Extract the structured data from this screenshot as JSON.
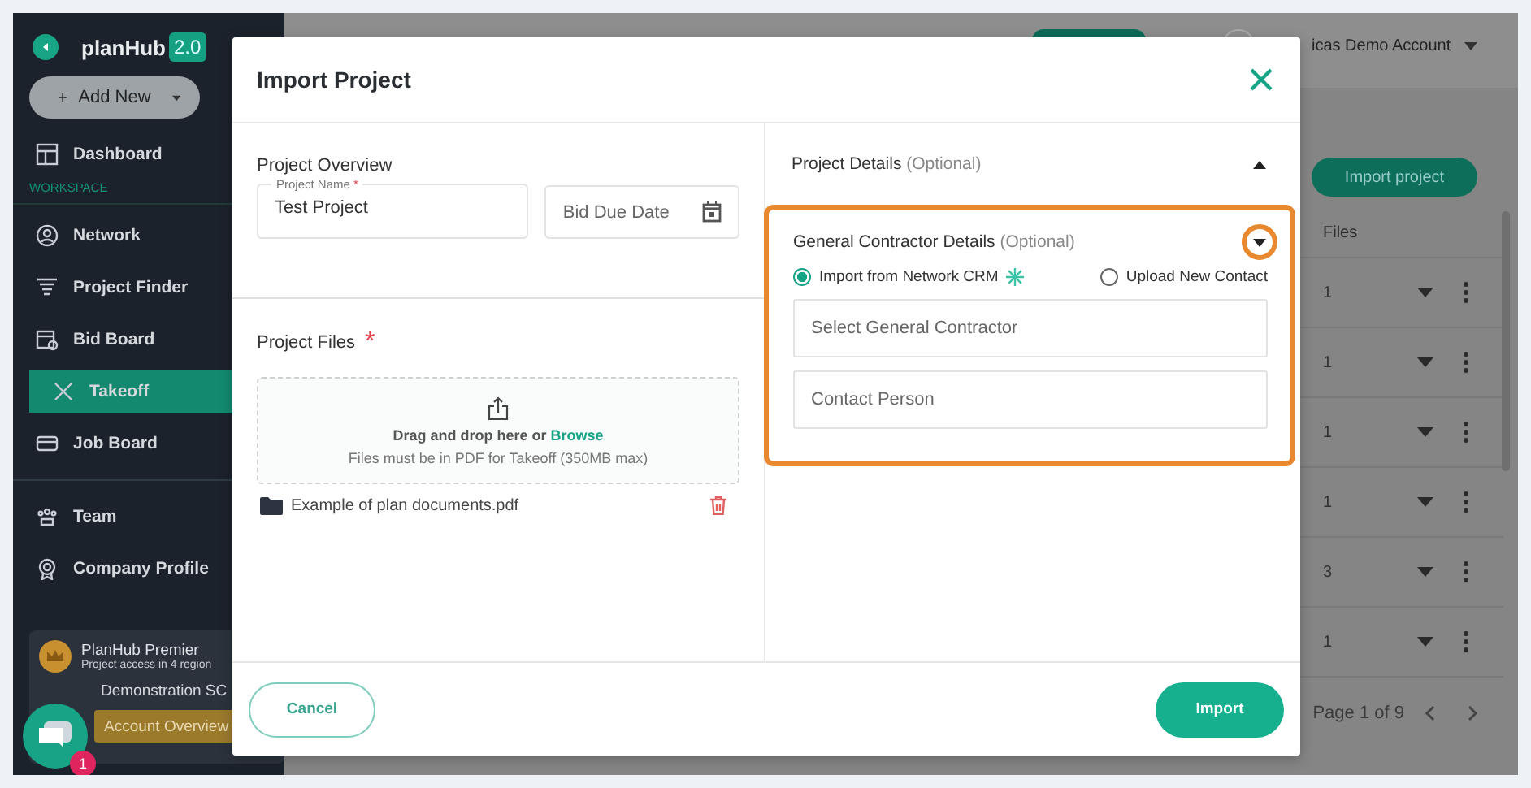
{
  "sidebar": {
    "logo": "planHub",
    "version": "2.0",
    "add_new": "Add New",
    "items": [
      {
        "kind": "item",
        "label": "Dashboard",
        "selected": false
      },
      {
        "kind": "section",
        "label": "WORKSPACE"
      },
      {
        "kind": "item",
        "label": "Network",
        "selected": false
      },
      {
        "kind": "item",
        "label": "Project Finder",
        "selected": false
      },
      {
        "kind": "item",
        "label": "Bid Board",
        "selected": false
      },
      {
        "kind": "item",
        "label": "Takeoff",
        "selected": true
      },
      {
        "kind": "item",
        "label": "Job Board",
        "selected": false
      },
      {
        "kind": "divider"
      },
      {
        "kind": "item",
        "label": "Team",
        "selected": false
      },
      {
        "kind": "item",
        "label": "Company Profile",
        "selected": false
      }
    ],
    "account": {
      "plan": "PlanHub Premier",
      "access": "Project access in 4 region",
      "company": "Demonstration SC",
      "button": "Account Overview"
    },
    "chat_badge": "1"
  },
  "header": {
    "account": "icas Demo Account"
  },
  "main": {
    "import_button": "Import project",
    "table": {
      "columns": [
        "Files"
      ],
      "rows": [
        {
          "files": "1"
        },
        {
          "files": "1"
        },
        {
          "files": "1"
        },
        {
          "files": "1"
        },
        {
          "files": "3"
        },
        {
          "files": "1"
        }
      ]
    },
    "pagination": "Page 1 of 9"
  },
  "modal": {
    "title": "Import Project",
    "overview": {
      "heading": "Project Overview",
      "name_label": "Project Name",
      "name_required_mark": "*",
      "name_value": "Test Project",
      "date_placeholder": "Bid Due Date"
    },
    "files": {
      "heading": "Project Files",
      "required_mark": "*",
      "drop_text": "Drag and drop here or",
      "browse": "Browse",
      "hint": "Files must be in PDF for Takeoff (350MB max)",
      "items": [
        {
          "name": "Example of plan documents.pdf"
        }
      ]
    },
    "project_details": {
      "title": "Project Details",
      "hint": "(Optional)",
      "expanded": false
    },
    "gc_details": {
      "title": "General Contractor Details",
      "hint": "(Optional)",
      "expanded": true,
      "highlighted": true,
      "options": [
        {
          "label": "Import from Network CRM",
          "selected": true,
          "sparkle": true
        },
        {
          "label": "Upload New Contact",
          "selected": false,
          "sparkle": false
        }
      ],
      "fields": [
        {
          "placeholder": "Select General Contractor"
        },
        {
          "placeholder": "Contact Person"
        }
      ]
    },
    "cancel": "Cancel",
    "import": "Import"
  }
}
